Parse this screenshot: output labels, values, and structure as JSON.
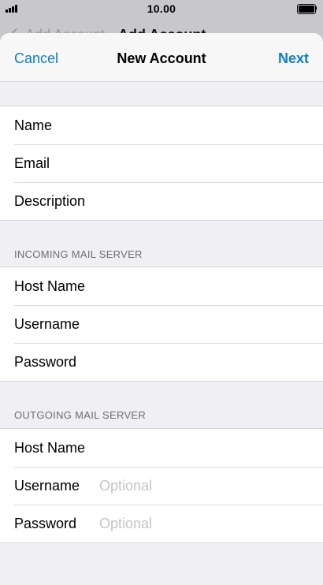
{
  "status_bar": {
    "time": "10.00"
  },
  "background_nav": {
    "back_label": "Add Account",
    "title": "Add Account"
  },
  "nav": {
    "cancel_label": "Cancel",
    "title": "New Account",
    "next_label": "Next"
  },
  "account_group": {
    "rows": [
      {
        "label": "Name",
        "value": "",
        "placeholder": ""
      },
      {
        "label": "Email",
        "value": "",
        "placeholder": ""
      },
      {
        "label": "Description",
        "value": "",
        "placeholder": ""
      }
    ]
  },
  "incoming": {
    "header": "INCOMING MAIL SERVER",
    "rows": [
      {
        "label": "Host Name",
        "value": "",
        "placeholder": ""
      },
      {
        "label": "Username",
        "value": "",
        "placeholder": ""
      },
      {
        "label": "Password",
        "value": "",
        "placeholder": ""
      }
    ]
  },
  "outgoing": {
    "header": "OUTGOING MAIL SERVER",
    "rows": [
      {
        "label": "Host Name",
        "value": "",
        "placeholder": ""
      },
      {
        "label": "Username",
        "value": "",
        "placeholder": "Optional"
      },
      {
        "label": "Password",
        "value": "",
        "placeholder": "Optional"
      }
    ]
  },
  "colors": {
    "accent": "#0a7ed4",
    "grouped_background": "#efeff4",
    "section_header": "#6d6d72",
    "placeholder": "#c4c4c9"
  },
  "icons": {
    "signal": "cellular-signal-icon",
    "battery": "battery-full-icon",
    "back": "chevron-left-icon"
  }
}
